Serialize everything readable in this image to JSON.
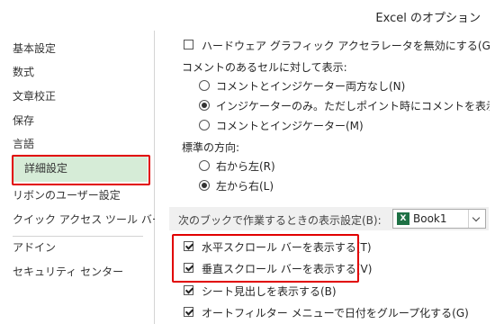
{
  "window": {
    "title": "Excel のオプション"
  },
  "sidebar": {
    "items": [
      {
        "label": "基本設定"
      },
      {
        "label": "数式"
      },
      {
        "label": "文章校正"
      },
      {
        "label": "保存"
      },
      {
        "label": "言語"
      },
      {
        "label": "詳細設定",
        "selected": true
      },
      {
        "label": "リボンのユーザー設定"
      },
      {
        "label": "クイック アクセス ツール バー"
      },
      {
        "label": "アドイン"
      },
      {
        "label": "セキュリティ センター"
      }
    ]
  },
  "main": {
    "hw_accel": {
      "label": "ハードウェア グラフィック アクセラレータを無効にする(G)",
      "checked": false
    },
    "comments": {
      "heading": "コメントのあるセルに対して表示:",
      "options": [
        {
          "label": "コメントとインジケーター両方なし(N)",
          "checked": false
        },
        {
          "label": "インジケーターのみ。ただしポイント時にコメントを表示(I)",
          "checked": true
        },
        {
          "label": "コメントとインジケーター(M)",
          "checked": false
        }
      ]
    },
    "direction": {
      "heading": "標準の方向:",
      "options": [
        {
          "label": "右から左(R)",
          "checked": false
        },
        {
          "label": "左から右(L)",
          "checked": true
        }
      ]
    },
    "workbook_section": {
      "label": "次のブックで作業するときの表示設定(B):",
      "selected_workbook": "Book1",
      "excel_icon": "X"
    },
    "workbook_options": [
      {
        "label": "水平スクロール バーを表示する(T)",
        "checked": true
      },
      {
        "label": "垂直スクロール バーを表示する(V)",
        "checked": true
      },
      {
        "label": "シート見出しを表示する(B)",
        "checked": true
      },
      {
        "label": "オートフィルター メニューで日付をグループ化する(G)",
        "checked": true
      }
    ]
  },
  "colors": {
    "highlight_border": "#e10000",
    "selected_nav_bg": "#d6ecd7",
    "excel_green": "#1e7145"
  }
}
